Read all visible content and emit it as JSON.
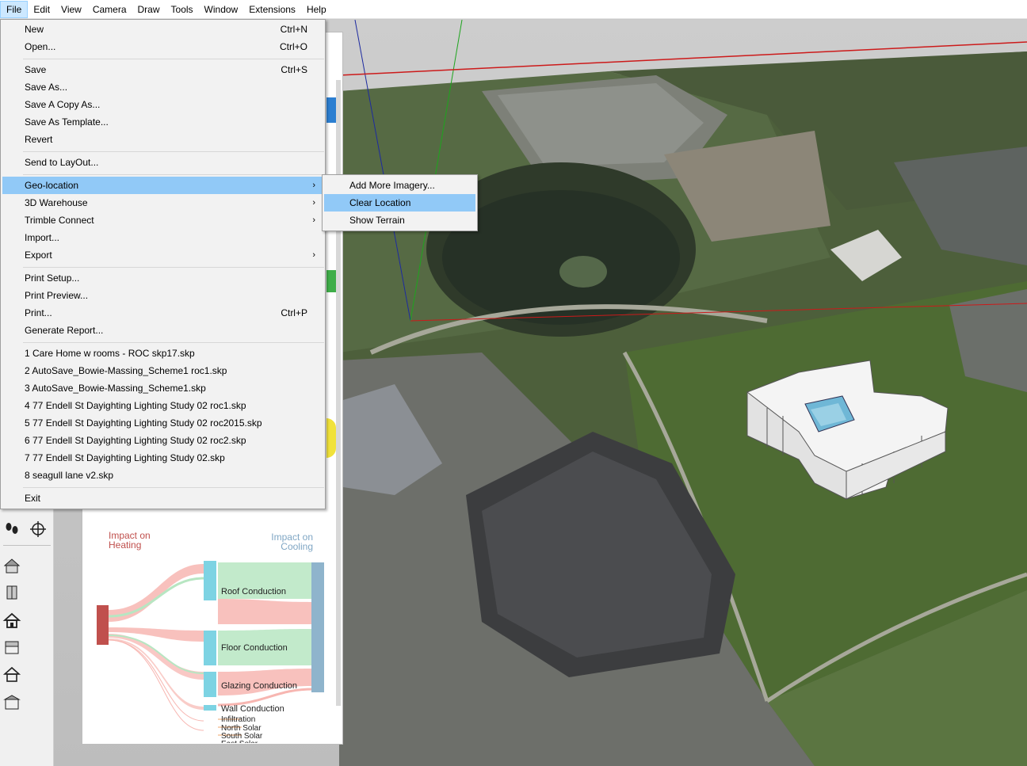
{
  "menubar": {
    "items": [
      "File",
      "Edit",
      "View",
      "Camera",
      "Draw",
      "Tools",
      "Window",
      "Extensions",
      "Help"
    ]
  },
  "file_menu": {
    "items": [
      {
        "label": "New",
        "shortcut": "Ctrl+N"
      },
      {
        "label": "Open...",
        "shortcut": "Ctrl+O"
      },
      {
        "label": "Save",
        "shortcut": "Ctrl+S"
      },
      {
        "label": "Save As...",
        "shortcut": ""
      },
      {
        "label": "Save A Copy As...",
        "shortcut": ""
      },
      {
        "label": "Save As Template...",
        "shortcut": ""
      },
      {
        "label": "Revert",
        "shortcut": ""
      },
      {
        "label": "Send to LayOut...",
        "shortcut": ""
      },
      {
        "label": "Geo-location",
        "shortcut": "",
        "submenu": true,
        "highlighted": true
      },
      {
        "label": "3D Warehouse",
        "shortcut": "",
        "submenu": true
      },
      {
        "label": "Trimble Connect",
        "shortcut": "",
        "submenu": true
      },
      {
        "label": "Import...",
        "shortcut": ""
      },
      {
        "label": "Export",
        "shortcut": "",
        "submenu": true
      },
      {
        "label": "Print Setup...",
        "shortcut": ""
      },
      {
        "label": "Print Preview...",
        "shortcut": ""
      },
      {
        "label": "Print...",
        "shortcut": "Ctrl+P"
      },
      {
        "label": "Generate Report...",
        "shortcut": ""
      },
      {
        "label": "1 Care Home w rooms - ROC skp17.skp",
        "shortcut": ""
      },
      {
        "label": "2 AutoSave_Bowie-Massing_Scheme1 roc1.skp",
        "shortcut": ""
      },
      {
        "label": "3 AutoSave_Bowie-Massing_Scheme1.skp",
        "shortcut": ""
      },
      {
        "label": "4 77 Endell St Dayighting Lighting Study 02 roc1.skp",
        "shortcut": ""
      },
      {
        "label": "5 77 Endell St Dayighting Lighting Study 02 roc2015.skp",
        "shortcut": ""
      },
      {
        "label": "6 77 Endell St Dayighting Lighting Study 02 roc2.skp",
        "shortcut": ""
      },
      {
        "label": "7 77 Endell St Dayighting Lighting Study 02.skp",
        "shortcut": ""
      },
      {
        "label": "8 seagull lane v2.skp",
        "shortcut": ""
      },
      {
        "label": "Exit",
        "shortcut": ""
      }
    ]
  },
  "geo_submenu": {
    "items": [
      {
        "label": "Add More Imagery...",
        "highlighted": false
      },
      {
        "label": "Clear Location",
        "highlighted": true
      },
      {
        "label": "Show Terrain",
        "highlighted": false
      }
    ]
  },
  "sankey": {
    "left_title": "Impact on\nHeating",
    "right_title": "Impact on\nCooling",
    "nodes": [
      "Roof Conduction",
      "Floor Conduction",
      "Glazing Conduction",
      "Wall Conduction",
      "Infiltration",
      "North Solar",
      "South Solar",
      "East Solar"
    ],
    "colors": {
      "heating": "#c0504d",
      "cooling": "#8fb4cc",
      "heat_flow": "#f7b6b1",
      "cool_flow": "#b7e6c2",
      "node": "#7dd3e3"
    }
  },
  "toolbar_icons": [
    "footprints-icon",
    "position-camera-icon",
    "house-icon",
    "box-icon",
    "house-outline-icon",
    "building-icon",
    "house-icon-2",
    "building-icon-2"
  ]
}
